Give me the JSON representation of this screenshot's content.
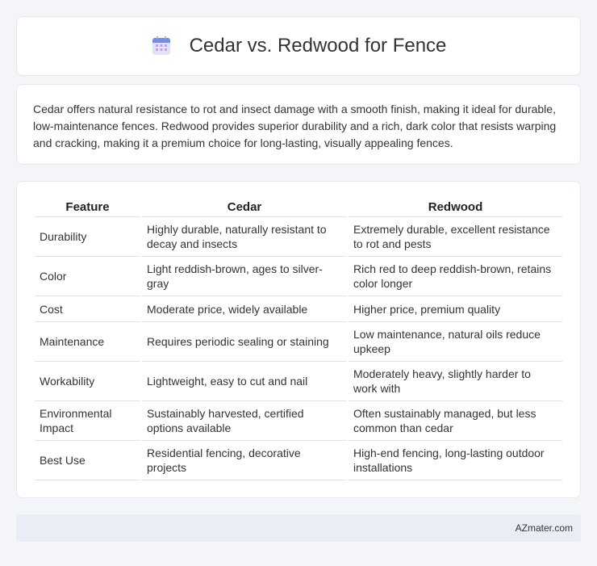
{
  "header": {
    "title": "Cedar vs. Redwood for Fence",
    "icon": "calendar-icon"
  },
  "intro": {
    "text": "Cedar offers natural resistance to rot and insect damage with a smooth finish, making it ideal for durable, low-maintenance fences. Redwood provides superior durability and a rich, dark color that resists warping and cracking, making it a premium choice for long-lasting, visually appealing fences."
  },
  "table": {
    "headers": [
      "Feature",
      "Cedar",
      "Redwood"
    ],
    "rows": [
      [
        "Durability",
        "Highly durable, naturally resistant to decay and insects",
        "Extremely durable, excellent resistance to rot and pests"
      ],
      [
        "Color",
        "Light reddish-brown, ages to silver-gray",
        "Rich red to deep reddish-brown, retains color longer"
      ],
      [
        "Cost",
        "Moderate price, widely available",
        "Higher price, premium quality"
      ],
      [
        "Maintenance",
        "Requires periodic sealing or staining",
        "Low maintenance, natural oils reduce upkeep"
      ],
      [
        "Workability",
        "Lightweight, easy to cut and nail",
        "Moderately heavy, slightly harder to work with"
      ],
      [
        "Environmental Impact",
        "Sustainably harvested, certified options available",
        "Often sustainably managed, but less common than cedar"
      ],
      [
        "Best Use",
        "Residential fencing, decorative projects",
        "High-end fencing, long-lasting outdoor installations"
      ]
    ]
  },
  "footer": {
    "text": "AZmater.com"
  }
}
